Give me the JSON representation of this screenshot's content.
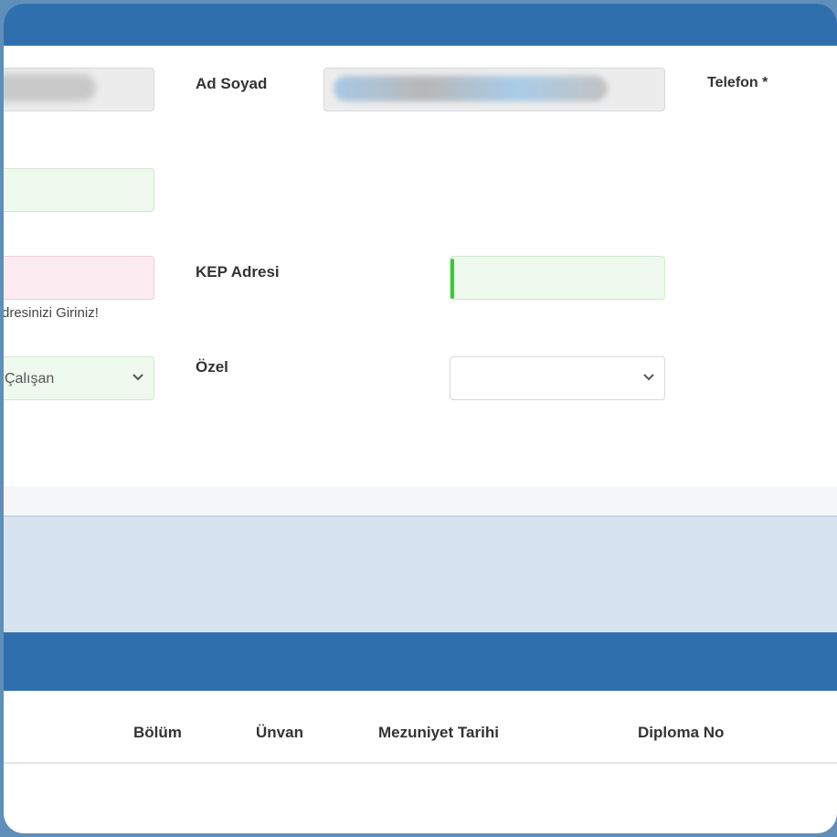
{
  "form": {
    "ad_soyad_label": "Ad Soyad",
    "telefon_label": "Telefon *",
    "kep_label": "KEP Adresi",
    "email_hint": "dresinizi Giriniz!",
    "calisan_value": "Çalışan",
    "ozel_label": "Özel",
    "ozel_value": ""
  },
  "table": {
    "headers": [
      "Bölüm",
      "Ünvan",
      "Mezuniyet Tarihi",
      "Diploma No"
    ]
  },
  "colors": {
    "header_bar": "#2f6fae",
    "band": "#d7e3f1",
    "input_green": "#eefaee",
    "input_pink": "#fdebf2",
    "focus_caret": "#2fd12f"
  },
  "icons": {
    "select_arrow": "chevron-down-icon"
  }
}
